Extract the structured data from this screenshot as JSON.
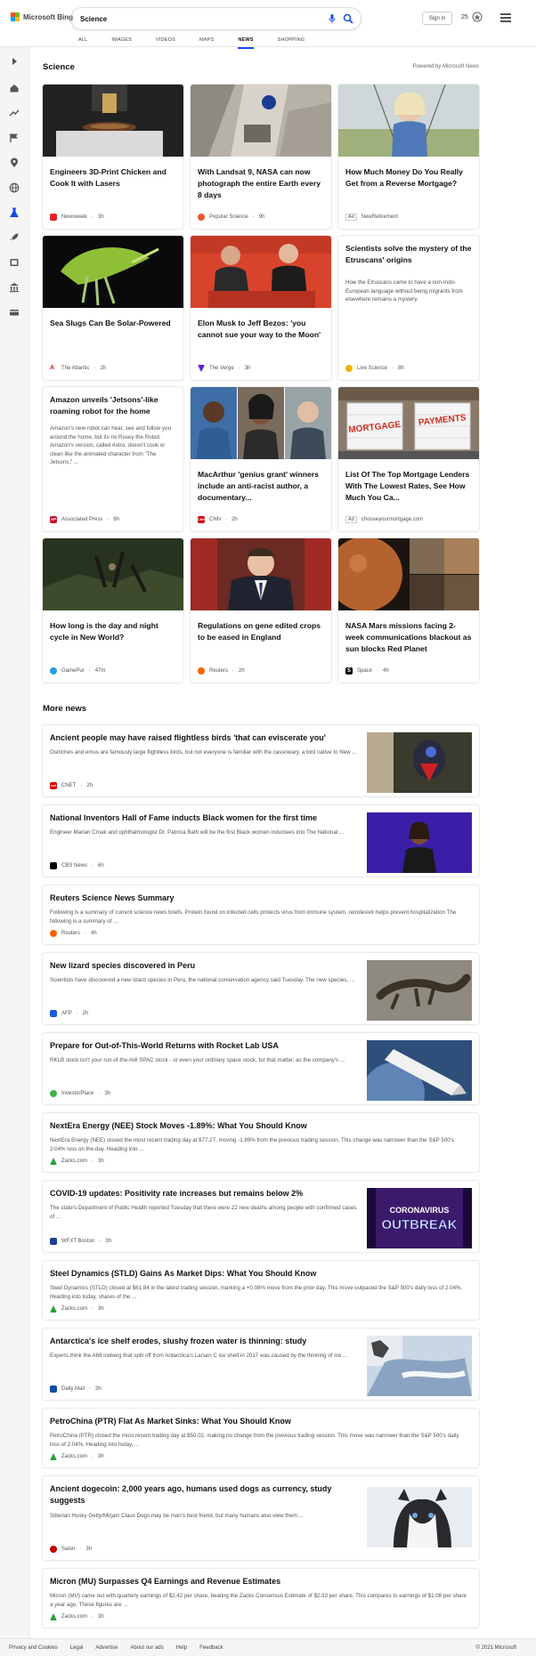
{
  "header": {
    "brand": "Microsoft Bing",
    "search_value": "Science",
    "signin_label": "Sign in",
    "rewards_count": "25",
    "tabs": [
      {
        "label": "ALL"
      },
      {
        "label": "IMAGES"
      },
      {
        "label": "VIDEOS"
      },
      {
        "label": "MAPS"
      },
      {
        "label": "NEWS"
      },
      {
        "label": "SHOPPING"
      }
    ]
  },
  "section": {
    "title": "Science",
    "powered_by": "Powered by Microsoft News"
  },
  "cards": [
    {
      "title": "Engineers 3D-Print Chicken and Cook It with Lasers",
      "desc": "",
      "source": "Newsweek",
      "time": "3h"
    },
    {
      "title": "With Landsat 9, NASA can now photograph the entire Earth every 8 days",
      "desc": "",
      "source": "Popular Science",
      "time": "9h"
    },
    {
      "title": "How Much Money Do You Really Get from a Reverse Mortgage?",
      "desc": "",
      "source": "NewRetirement",
      "time": "",
      "ad": "Ad"
    },
    {
      "title": "Sea Slugs Can Be Solar-Powered",
      "desc": "",
      "source": "The Atlantic",
      "time": "2h"
    },
    {
      "title": "Elon Musk to Jeff Bezos: 'you cannot sue your way to the Moon'",
      "desc": "",
      "source": "The Verge",
      "time": "3h"
    },
    {
      "title": "Scientists solve the mystery of the Etruscans' origins",
      "desc": "How the Etruscans came to have a non-Indo-European language without being migrants from elsewhere remains a mystery.",
      "source": "Live Science",
      "time": "8h"
    },
    {
      "title": "Amazon unveils 'Jetsons'-like roaming robot for the home",
      "desc": "Amazon's new robot can hear, see and follow you around the home, but its no Rosey the Robot. Amazon's version, called Astro, doesn't cook or clean like the animated character from \"The Jetsons,\" ...",
      "source": "Associated Press",
      "time": "6h"
    },
    {
      "title": "MacArthur 'genius grant' winners include an anti-racist author, a documentary...",
      "desc": "",
      "source": "CNN",
      "time": "2h"
    },
    {
      "title": "List Of The Top Mortgage Lenders With The Lowest Rates, See How Much You Ca...",
      "desc": "",
      "source": "chooseyourmortgage.com",
      "time": "",
      "ad": "Ad"
    },
    {
      "title": "How long is the day and night cycle in New World?",
      "desc": "",
      "source": "GamePur",
      "time": "47m"
    },
    {
      "title": "Regulations on gene edited crops to be eased in England",
      "desc": "",
      "source": "Reuters",
      "time": "2h"
    },
    {
      "title": "NASA Mars missions facing 2-week communications blackout as sun blocks Red Planet",
      "desc": "",
      "source": "Space",
      "time": "4h"
    }
  ],
  "card_image_text": {
    "mortgage": "MORTGAGE",
    "payments": "PAYMENTS"
  },
  "more_news_title": "More news",
  "news": [
    {
      "title": "Ancient people may have raised flightless birds 'that can eviscerate you'",
      "desc": "Ostriches and emus are famously large flightless birds, but not everyone is familiar with the cassowary, a bird native to New ...",
      "source": "CNET",
      "time": "2h"
    },
    {
      "title": "National Inventors Hall of Fame inducts Black women for the first time",
      "desc": "Engineer Marian Croak and ophthalmologist Dr. Patricia Bath will be the first Black women inductees into The National ...",
      "source": "CBS News",
      "time": "6h"
    },
    {
      "title": "Reuters Science News Summary",
      "desc": "Following is a summary of current science news briefs. Protein found on infected cells protects virus from immune system, remdesivir helps prevent hospitalization The following is a summary of ...",
      "source": "Reuters",
      "time": "4h"
    },
    {
      "title": "New lizard species discovered in Peru",
      "desc": "Scientists have discovered a new lizard species in Peru, the national conservation agency said Tuesday. The new species, ...",
      "source": "AFP",
      "time": "2h"
    },
    {
      "title": "Prepare for Out-of-This-World Returns with Rocket Lab USA",
      "desc": "RKLB stock isn't your run-of-the-mill SPAC stock - or even your ordinary space stock, for that matter, as the company's ...",
      "source": "InvestorPlace",
      "time": "3h"
    },
    {
      "title": "NextEra Energy (NEE) Stock Moves -1.89%: What You Should Know",
      "desc": "NextEra Energy (NEE) closed the most recent trading day at $77.27, moving -1.89% from the previous trading session. This change was narrower than the S&P 500's 2.04% loss on the day. Heading into ...",
      "source": "Zacks.com",
      "time": "3h"
    },
    {
      "title": "COVID-19 updates: Positivity rate increases but remains below 2%",
      "desc": "The state's Department of Public Health reported Tuesday that there were 22 new deaths among people with confirmed cases of ...",
      "source": "WFXT Boston",
      "time": "3h"
    },
    {
      "title": "Steel Dynamics (STLD) Gains As Market Dips: What You Should Know",
      "desc": "Steel Dynamics (STLD) closed at $61.84 in the latest trading session, marking a +0.08% move from the prior day. This move outpaced the S&P 500's daily loss of 2.04%. Heading into today, shares of the ...",
      "source": "Zacks.com",
      "time": "3h"
    },
    {
      "title": "Antarctica's ice shelf erodes, slushy frozen water is thinning: study",
      "desc": "Experts think the A68 iceberg that split off from Antarctica's Larsen C ice shelf in 2017 was caused by the thinning of ice ...",
      "source": "Daily Mail",
      "time": "3h"
    },
    {
      "title": "PetroChina (PTR) Flat As Market Sinks: What You Should Know",
      "desc": "PetroChina (PTR) closed the most recent trading day at $50.02, making no change from the previous trading session. This move was narrower than the S&P 500's daily loss of 2.04%. Heading into today, ...",
      "source": "Zacks.com",
      "time": "3h"
    },
    {
      "title": "Ancient dogecoin: 2,000 years ago, humans used dogs as currency, study suggests",
      "desc": "Siberian Husky Getty/Mirjam Claus Dogs may be man's best friend, but many humans also view them ...",
      "source": "Salon",
      "time": "3h"
    },
    {
      "title": "Micron (MU) Surpasses Q4 Earnings and Revenue Estimates",
      "desc": "Micron (MU) came out with quarterly earnings of $2.42 per share, beating the Zacks Consensus Estimate of $2.33 per share. This compares to earnings of $1.08 per share a year ago. These figures are ...",
      "source": "Zacks.com",
      "time": "3h"
    }
  ],
  "news_thumb_text": {
    "covid_line1": "CORONAVIRUS",
    "covid_line2": "OUTBREAK"
  },
  "footer": {
    "links": [
      "Privacy and Cookies",
      "Legal",
      "Advertise",
      "About our ads",
      "Help",
      "Feedback"
    ],
    "copyright": "© 2021 Microsoft"
  },
  "colors": {
    "accent": "#174ae4",
    "sidebar_bg": "#f5f5f5"
  }
}
